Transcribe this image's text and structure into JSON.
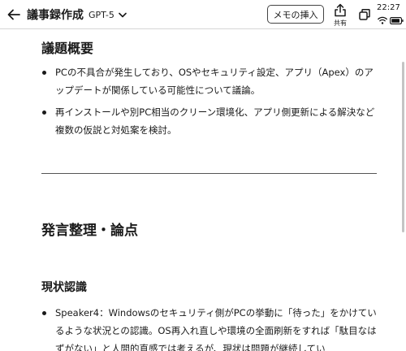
{
  "header": {
    "title": "議事録作成",
    "model": "GPT-5",
    "memo_button": "メモの挿入",
    "share_label": "共有"
  },
  "status_bar": {
    "time": "22:27"
  },
  "sections": {
    "topic_heading": "議題概要",
    "topic_items": [
      "PCの不具合が発生しており、OSやセキュリティ設定、アプリ（Apex）のアップデートが関係している可能性について議論。",
      "再インストールや別PC相当のクリーン環境化、アプリ側更新による解決など複数の仮説と対処案を検討。"
    ],
    "speech_heading": "発言整理・論点",
    "status_heading": "現状認識",
    "status_items": [
      "Speaker4：Windowsのセキュリティ側がPCの挙動に「待った」をかけているような状況との認識。OS再入れ直しや環境の全面刷新をすれば「駄目なはずがない」と人間的直感では考えるが、現状は問題が継続してい"
    ]
  },
  "icons": {
    "back": "arrow-left-icon",
    "model_toggle": "chevron-down-icon",
    "share": "share-icon",
    "copy": "copy-icon",
    "wifi": "wifi-icon",
    "battery": "battery-icon"
  }
}
